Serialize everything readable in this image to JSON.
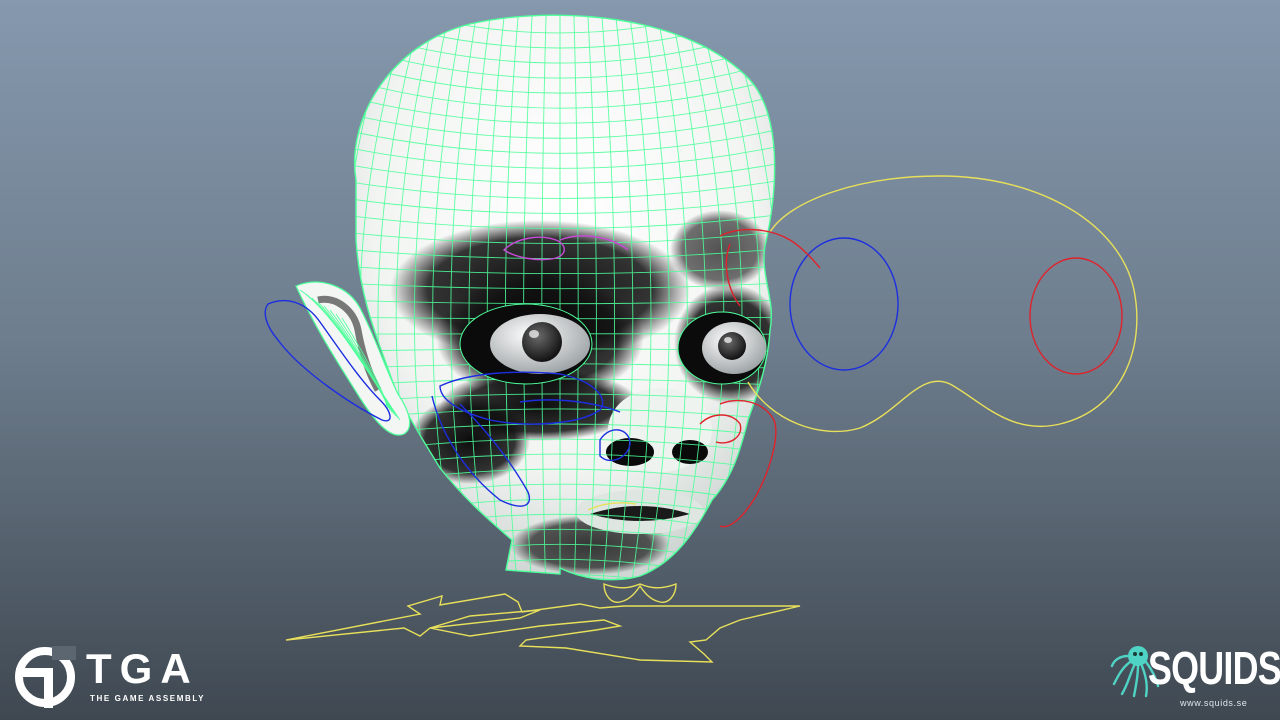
{
  "scene": {
    "background_top": "#8598ad",
    "background_bottom": "#3f4851",
    "wireframe_color": "#4dff9a",
    "control_colors": {
      "blue": "#1c2ee0",
      "red": "#e0222a",
      "yellow": "#e8e05a",
      "magenta": "#c64ad6"
    }
  },
  "logos": {
    "tga": {
      "wordmark": "TGA",
      "tagline": "THE GAME ASSEMBLY",
      "icon": "tga-circle-icon"
    },
    "squids": {
      "wordmark": "SQUIDS",
      "url": "www.squids.se",
      "icon": "squid-mascot-icon",
      "color": "#4fd3c4"
    }
  }
}
